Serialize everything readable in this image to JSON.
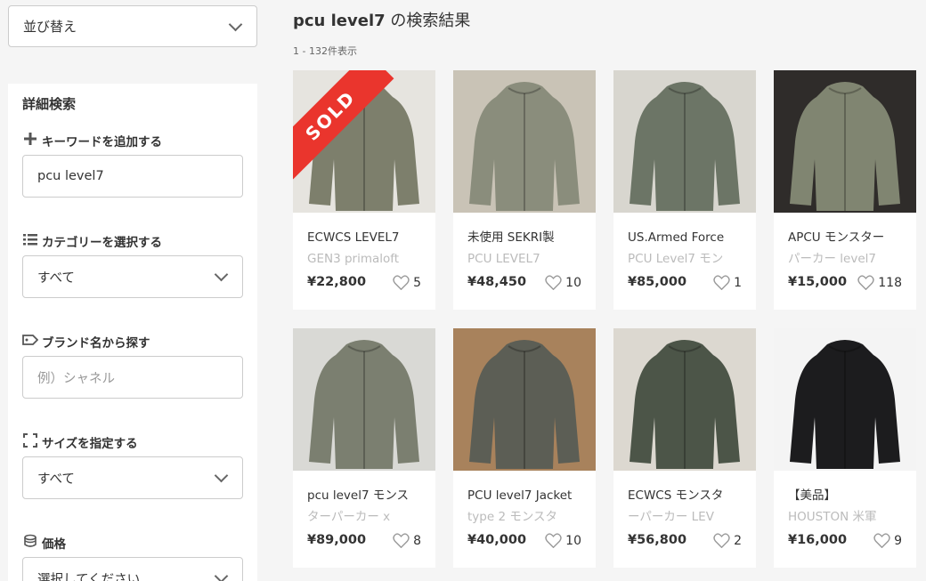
{
  "sort": {
    "label": "並び替え"
  },
  "panel": {
    "title": "詳細検索",
    "keyword": {
      "label": "キーワードを追加する",
      "value": "pcu level7"
    },
    "category": {
      "label": "カテゴリーを選択する",
      "value": "すべて"
    },
    "brand": {
      "label": "ブランド名から探す",
      "placeholder": "例）シャネル"
    },
    "size": {
      "label": "サイズを指定する",
      "value": "すべて"
    },
    "price": {
      "label": "価格",
      "value": "選択してください"
    }
  },
  "results": {
    "query": "pcu level7",
    "suffix": " の検索結果",
    "count": "1 - 132件表示"
  },
  "items": [
    {
      "line1": "ECWCS LEVEL7",
      "line2": "GEN3 primaloft",
      "price": "¥22,800",
      "likes": "5",
      "sold": "SOLD",
      "color": "#7d7f6c",
      "bg": "#e6e4df"
    },
    {
      "line1": "未使用 SEKRI製",
      "line2": "PCU LEVEL7",
      "price": "¥48,450",
      "likes": "10",
      "color": "#8a8d7c",
      "bg": "#c9c3b6"
    },
    {
      "line1": "US.Armed Force",
      "line2": "PCU Level7 モン",
      "price": "¥85,000",
      "likes": "1",
      "color": "#6c7566",
      "bg": "#d8d6cf"
    },
    {
      "line1": "APCU モンスター",
      "line2": "パーカー level7",
      "price": "¥15,000",
      "likes": "118",
      "color": "#808571",
      "bg": "#2f2c2a"
    },
    {
      "line1": "pcu level7 モンス",
      "line2": "ターパーカー x",
      "price": "¥89,000",
      "likes": "8",
      "color": "#7b7f70",
      "bg": "#d9d9d5"
    },
    {
      "line1": "PCU level7 Jacket",
      "line2": "type 2 モンスタ",
      "price": "¥40,000",
      "likes": "10",
      "color": "#5c5e55",
      "bg": "#a8825c"
    },
    {
      "line1": "ECWCS モンスタ",
      "line2": "ーパーカー LEV",
      "price": "¥56,800",
      "likes": "2",
      "color": "#4c5548",
      "bg": "#dcd8d0"
    },
    {
      "line1": "【美品】",
      "line2": "HOUSTON 米軍",
      "price": "¥16,000",
      "likes": "9",
      "color": "#1c1c1e",
      "bg": "#f4f4f4"
    }
  ]
}
